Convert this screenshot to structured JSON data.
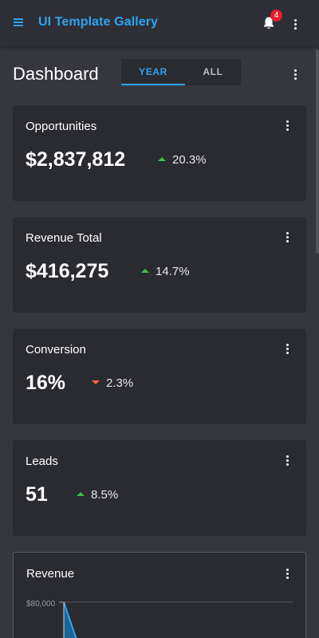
{
  "appbar": {
    "title": "UI Template Gallery",
    "notification_count": "4",
    "icons": [
      "menu-icon",
      "bell-icon",
      "more-vert-icon"
    ]
  },
  "dashboard": {
    "title": "Dashboard",
    "tabs": [
      {
        "label": "YEAR",
        "active": true
      },
      {
        "label": "ALL",
        "active": false
      }
    ]
  },
  "cards": [
    {
      "title": "Opportunities",
      "value": "$2,837,812",
      "change": "20.3%",
      "direction": "up"
    },
    {
      "title": "Revenue Total",
      "value": "$416,275",
      "change": "14.7%",
      "direction": "up"
    },
    {
      "title": "Conversion",
      "value": "16%",
      "change": "2.3%",
      "direction": "down"
    },
    {
      "title": "Leads",
      "value": "51",
      "change": "8.5%",
      "direction": "up"
    }
  ],
  "revenue": {
    "title": "Revenue",
    "y_tick": "$80,000"
  },
  "colors": {
    "accent": "#2ea4f0",
    "up": "#3bbf4e",
    "down": "#ef6a3d",
    "badge": "#e8202a",
    "card": "#2a2a31",
    "background": "#36363f"
  }
}
